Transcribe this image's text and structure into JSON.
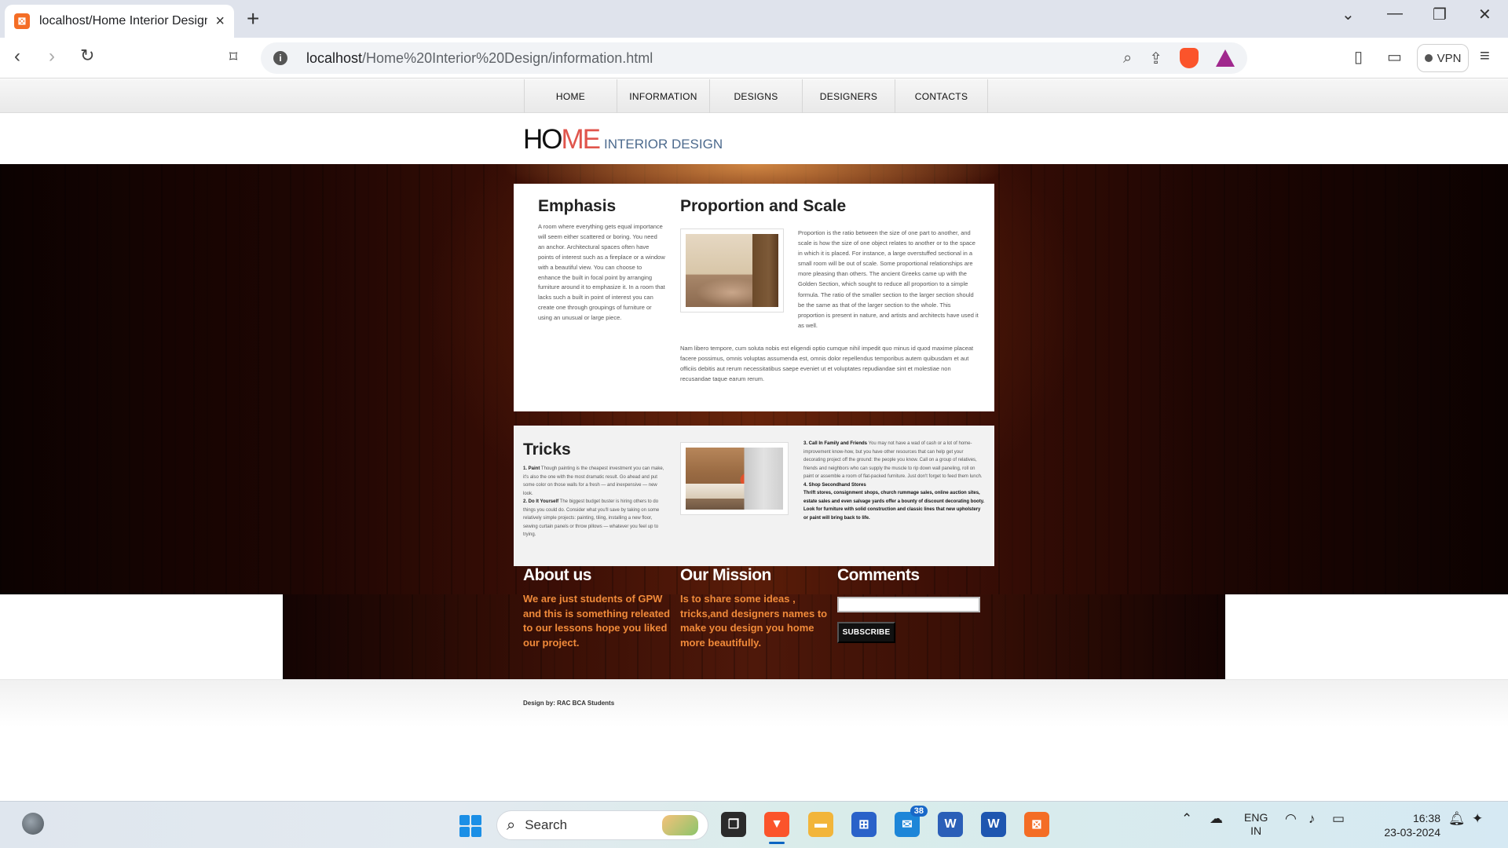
{
  "browser": {
    "tab_title": "localhost/Home Interior Design/",
    "tab_favicon_glyph": "⊠",
    "url_host": "localhost",
    "url_path": "/Home%20Interior%20Design/information.html",
    "vpn_label": "VPN",
    "icons": [
      "back-icon",
      "forward-icon",
      "reload-icon",
      "bookmark-icon",
      "site-info-icon",
      "zoom-icon",
      "share-icon",
      "brave-shields-icon",
      "brave-rewards-icon",
      "sidebar-icon",
      "wallet-icon",
      "menu-icon"
    ]
  },
  "site": {
    "menu": [
      "HOME",
      "INFORMATION",
      "DESIGNS",
      "DESIGNERS",
      "CONTACTS"
    ],
    "logo": {
      "part1": "HO",
      "part2": "ME",
      "sub": "INTERIOR DESIGN"
    },
    "emphasis": {
      "title": "Emphasis",
      "text": "A room where everything gets equal importance will seem either scattered or boring. You need an anchor. Architectural spaces often have points of interest such as a fireplace or a window with a beautiful view. You can choose to enhance the built in focal point by arranging furniture around it to emphasize it. In a room that lacks such a built in point of interest you can create one through groupings of furniture or using an unusual or large piece."
    },
    "proportion": {
      "title": "Proportion and Scale",
      "text": "Proportion is the ratio between the size of one part to another, and scale is how the size of one object relates to another or to the space in which it is placed. For instance, a large overstuffed sectional in a small room will be out of scale. Some proportional relationships are more pleasing than others. The ancient Greeks came up with the Golden Section, which sought to reduce all proportion to a simple formula. The ratio of the smaller section to the larger section should be the same as that of the larger section to the whole. This proportion is present in nature, and artists and architects have used it as well.",
      "text2": "Nam libero tempore, cum soluta nobis est eligendi optio cumque nihil impedit quo minus id quod maxime placeat facere possimus, omnis voluptas assumenda est, omnis dolor repellendus temporibus autem quibusdam et aut officiis debitis aut rerum necessitatibus saepe eveniet ut et voluptates repudiandae sint et molestiae non recusandae taque earum rerum."
    },
    "tricks": {
      "title": "Tricks",
      "item1_label": "1. Paint",
      "item1_text": " Though painting is the cheapest investment you can make, it's also the one with the most dramatic result. Go ahead and put some color on those walls for a fresh — and inexpensive — new look.",
      "item2_label": "2. Do It Yourself",
      "item2_text": " The biggest budget buster is hiring others to do things you could do. Consider what you'll save by taking on some relatively simple projects: painting, tiling, installing a new floor, sewing curtain panels or throw pillows — whatever you feel up to trying.",
      "item3_label": "3. Call In Family and Friends",
      "item3_text": " You may not have a wad of cash or a lot of home-improvement know-how, but you have other resources that can help get your decorating project off the ground: the people you know. Call on a group of relatives, friends and neighbors who can supply the muscle to rip down wall paneling, roll on paint or assemble a room of flat-packed furniture. Just don't forget to feed them lunch.",
      "item4_label": "4. Shop Secondhand Stores",
      "item4_text": "Thrift stores, consignment shops, church rummage sales, online auction sites, estate sales and even salvage yards offer a bounty of discount decorating booty. Look for furniture with solid construction and classic lines that new upholstery or paint will bring back to life."
    },
    "footer": {
      "about_title": "About us",
      "about_text": "We are just students of GPW and this is something releated to our lessons hope you liked our project.",
      "mission_title": "Our Mission",
      "mission_text": "Is to share some ideas , tricks,and designers names to make you design you home more beautifully.",
      "comments_title": "Comments",
      "comment_value": "",
      "subscribe_label": "SUBSCRIBE"
    },
    "credit": "Design by: RAC BCA Students"
  },
  "taskbar": {
    "search_label": "Search",
    "badge_count": "38",
    "lang_line1": "ENG",
    "lang_line2": "IN",
    "time": "16:38",
    "date": "23-03-2024"
  }
}
